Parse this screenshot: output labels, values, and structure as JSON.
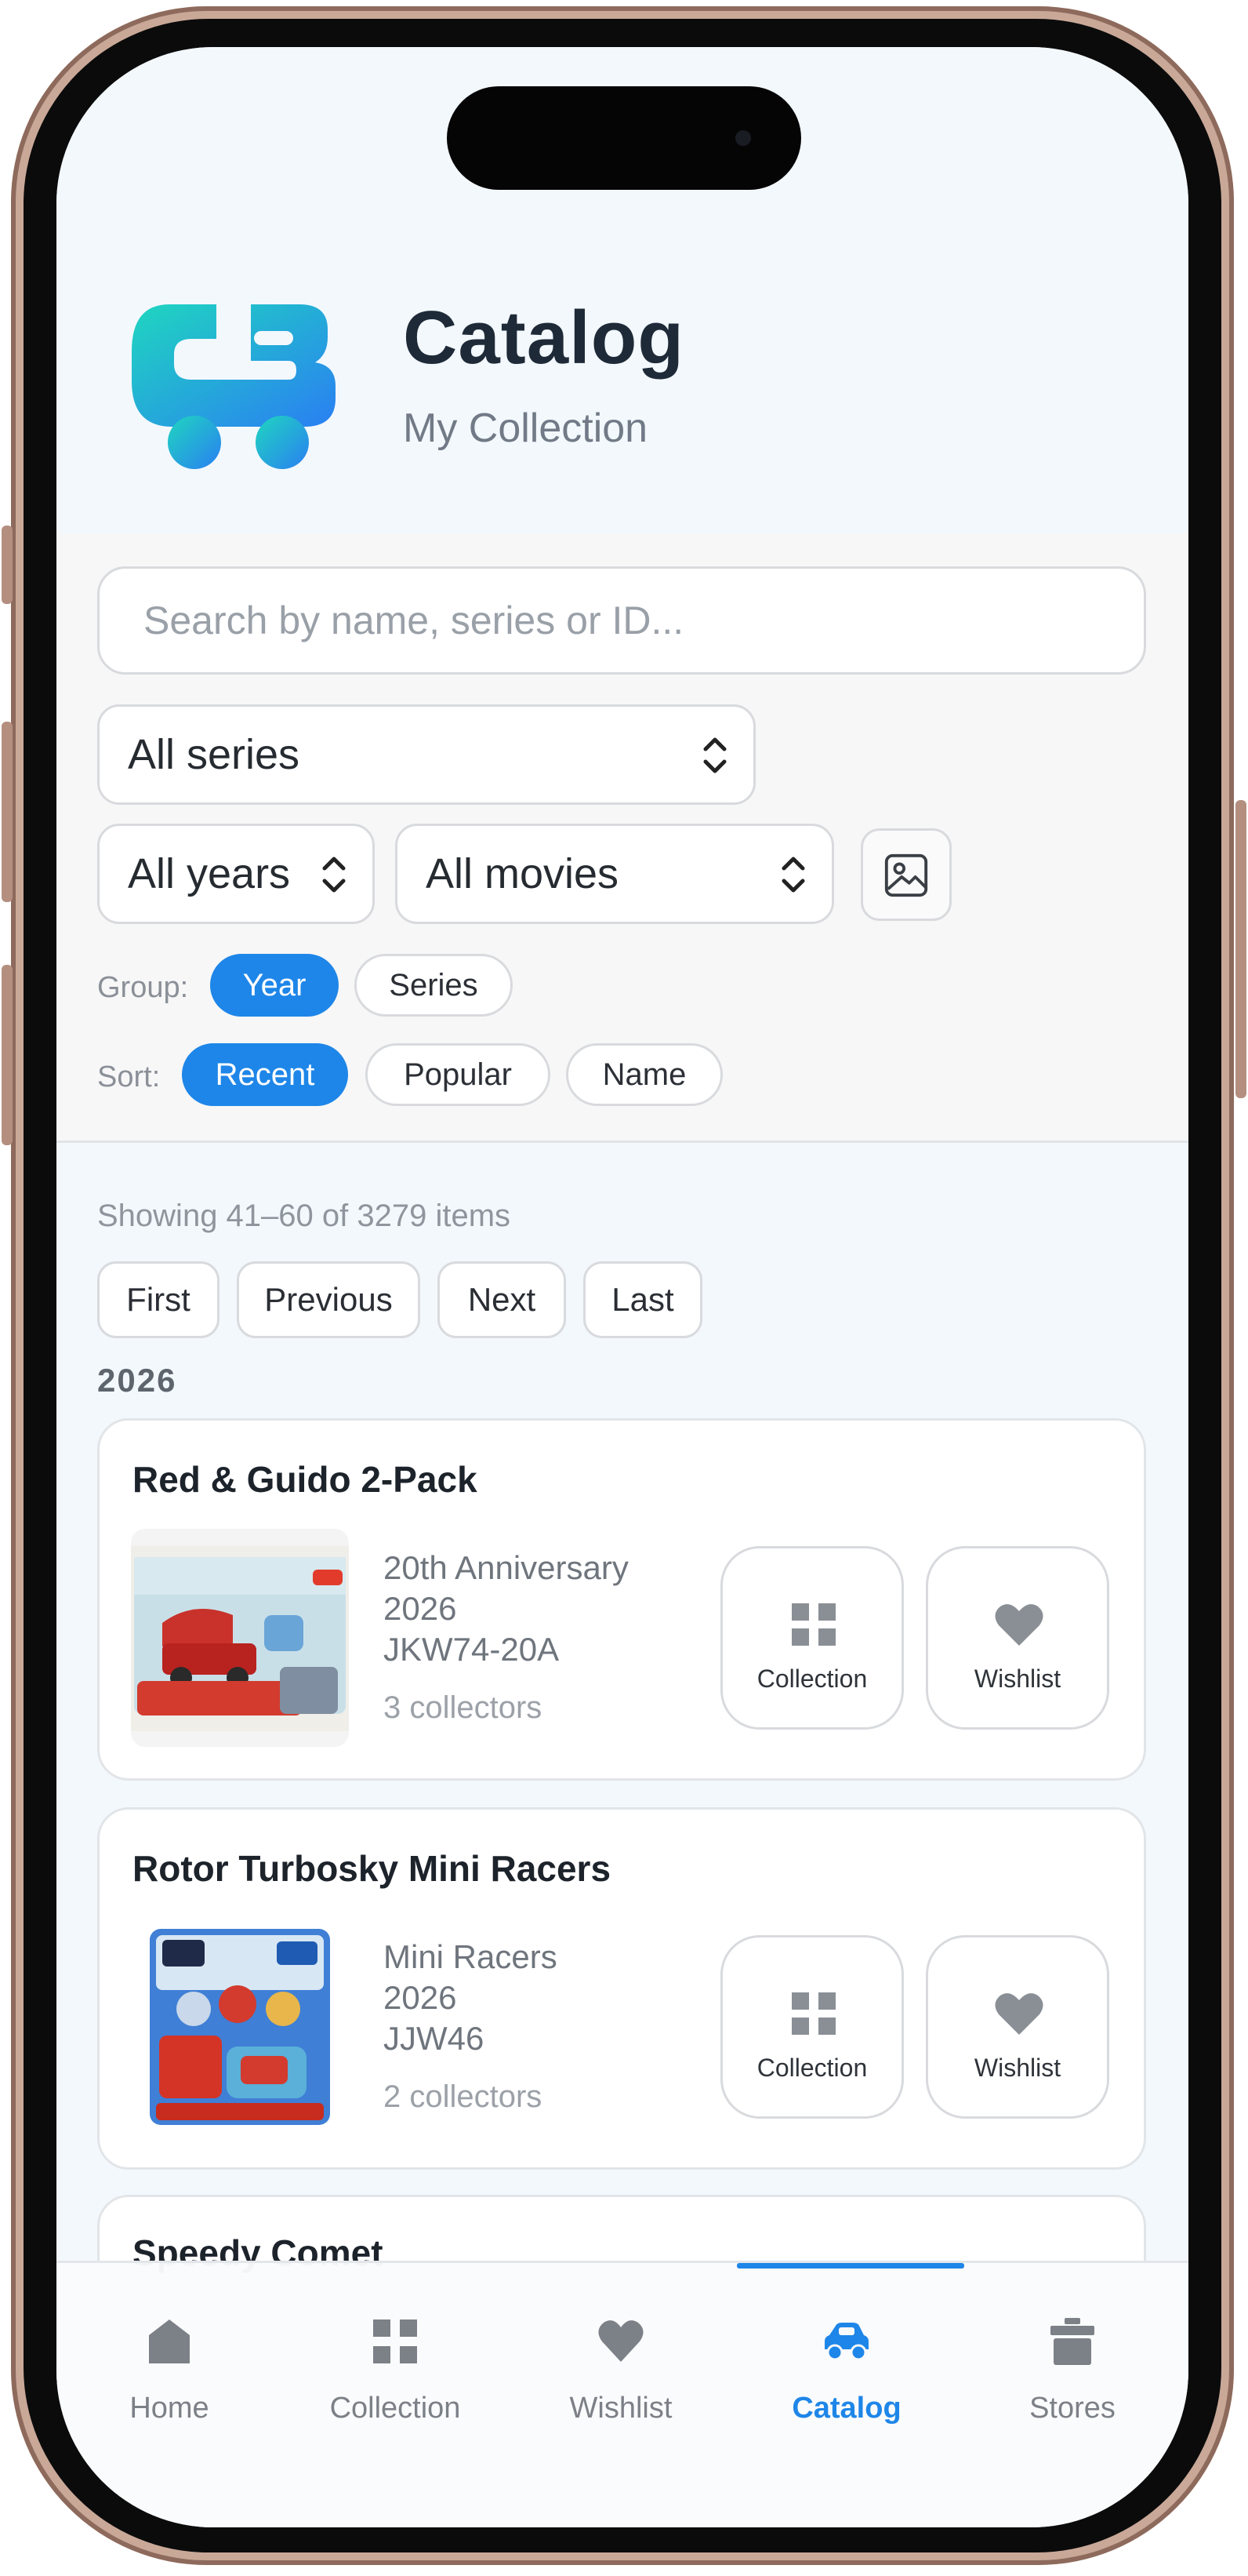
{
  "header": {
    "title": "Catalog",
    "subtitle": "My Collection"
  },
  "search": {
    "placeholder": "Search by name, series or ID..."
  },
  "filters": {
    "series_value": "All series",
    "years_value": "All years",
    "movies_value": "All movies",
    "group_label": "Group:",
    "group_options": [
      "Year",
      "Series"
    ],
    "group_selected": "Year",
    "sort_label": "Sort:",
    "sort_options": [
      "Recent",
      "Popular",
      "Name"
    ],
    "sort_selected": "Recent"
  },
  "results": {
    "showing": "Showing 41–60 of 3279 items",
    "pagination": [
      "First",
      "Previous",
      "Next",
      "Last"
    ],
    "group_heading": "2026"
  },
  "items": [
    {
      "name": "Red & Guido 2-Pack",
      "series": "20th Anniversary",
      "year": "2026",
      "id": "JKW74-20A",
      "collectors": "3 collectors",
      "collection_label": "Collection",
      "wishlist_label": "Wishlist"
    },
    {
      "name": "Rotor Turbosky Mini Racers",
      "series": "Mini Racers",
      "year": "2026",
      "id": "JJW46",
      "collectors": "2 collectors",
      "collection_label": "Collection",
      "wishlist_label": "Wishlist"
    },
    {
      "name": "Speedy Comet"
    }
  ],
  "tabbar": {
    "tabs": [
      {
        "label": "Home",
        "icon": "home-icon"
      },
      {
        "label": "Collection",
        "icon": "grid-icon"
      },
      {
        "label": "Wishlist",
        "icon": "heart-icon"
      },
      {
        "label": "Catalog",
        "icon": "car-icon"
      },
      {
        "label": "Stores",
        "icon": "store-icon"
      }
    ],
    "active": "Catalog"
  },
  "colors": {
    "accent": "#1e86e8",
    "logo_start": "#1fd0c2",
    "logo_end": "#2a87f0",
    "frame": "#c9a898"
  }
}
